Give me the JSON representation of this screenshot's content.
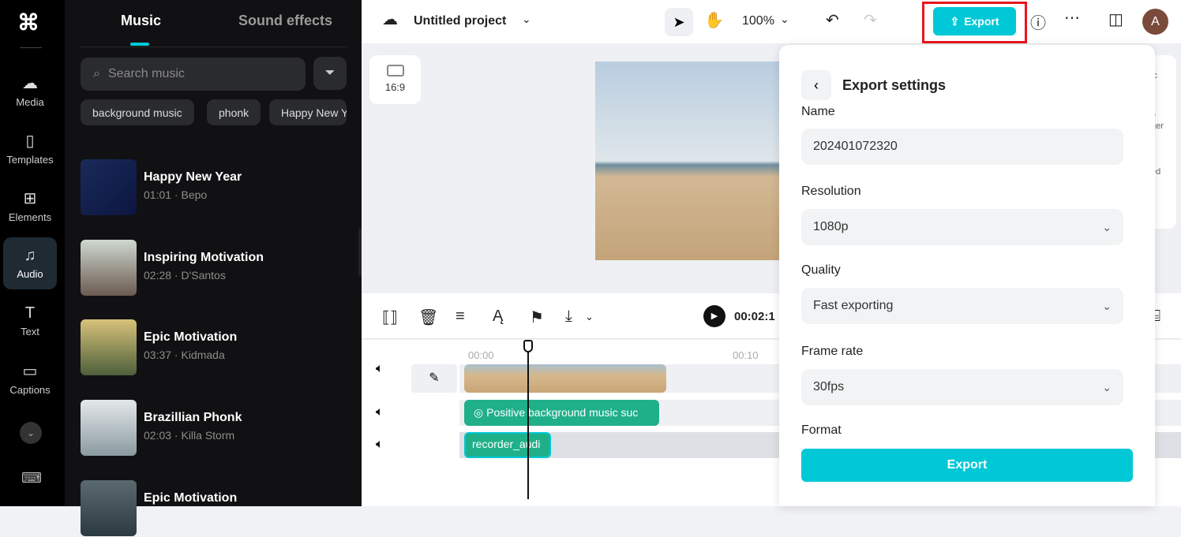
{
  "rail": {
    "items": [
      {
        "label": "Media",
        "icon": "cloud-upload-icon"
      },
      {
        "label": "Templates",
        "icon": "templates-icon"
      },
      {
        "label": "Elements",
        "icon": "elements-icon"
      },
      {
        "label": "Audio",
        "icon": "music-note-icon",
        "active": true
      },
      {
        "label": "Text",
        "icon": "text-icon"
      },
      {
        "label": "Captions",
        "icon": "captions-icon"
      }
    ]
  },
  "panel": {
    "tabs": [
      "Music",
      "Sound effects"
    ],
    "active_tab": "Music",
    "search_placeholder": "Search music",
    "chips": [
      "background music",
      "phonk",
      "Happy New Year"
    ],
    "tracks": [
      {
        "title": "Happy New Year",
        "meta": "01:01 · Bepo"
      },
      {
        "title": "Inspiring Motivation",
        "meta": "02:28 · D'Santos"
      },
      {
        "title": "Epic Motivation",
        "meta": "03:37 · Kidmada"
      },
      {
        "title": "Brazillian Phonk",
        "meta": "02:03 · Killa Storm"
      },
      {
        "title": "Epic Motivation",
        "meta": ""
      }
    ]
  },
  "topbar": {
    "project_title": "Untitled project",
    "zoom": "100%",
    "export_label": "Export",
    "avatar": "A"
  },
  "canvas": {
    "aspect_ratio": "16:9",
    "side_labels": [
      "ic",
      "e",
      "ger",
      "ed"
    ]
  },
  "timeline": {
    "time": "00:02:1",
    "ruler": [
      "00:00",
      "00:10"
    ],
    "clips": {
      "music": "Positive background music suc",
      "recorder": "recorder_audi"
    }
  },
  "export": {
    "title": "Export settings",
    "name_label": "Name",
    "name_value": "202401072320",
    "resolution_label": "Resolution",
    "resolution_value": "1080p",
    "quality_label": "Quality",
    "quality_value": "Fast exporting",
    "framerate_label": "Frame rate",
    "framerate_value": "30fps",
    "format_label": "Format",
    "export_button": "Export"
  },
  "colors": {
    "accent": "#00c8d7",
    "export_highlight": "#e8161c",
    "clip_green": "#1fb08a"
  }
}
